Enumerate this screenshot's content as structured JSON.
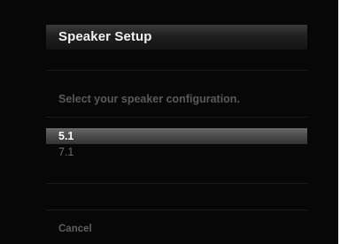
{
  "dialog": {
    "title": "Speaker Setup",
    "prompt": "Select your speaker configuration.",
    "options": [
      {
        "label": "5.1",
        "selected": true
      },
      {
        "label": "7.1",
        "selected": false
      }
    ],
    "cancel_label": "Cancel"
  }
}
